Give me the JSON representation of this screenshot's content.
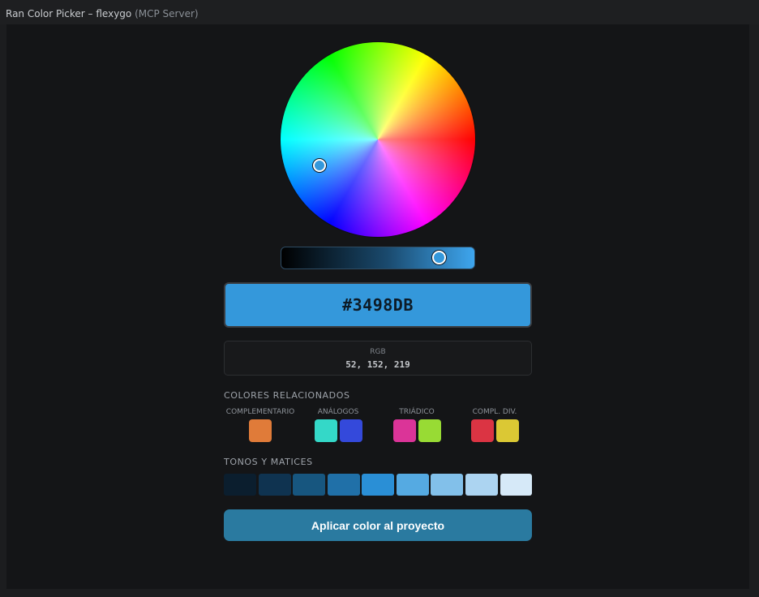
{
  "window": {
    "title_main": "Ran Color Picker – flexygo",
    "title_dim": " (MCP Server)"
  },
  "picker": {
    "current_color": "#3498db",
    "brightness_level_percent": 83
  },
  "hex": {
    "value": "#3498DB"
  },
  "rgb": {
    "label": "RGB",
    "value": "52, 152, 219"
  },
  "related": {
    "title": "COLORES RELACIONADOS",
    "groups": [
      {
        "label": "COMPLEMENTARIO",
        "colors": [
          "#e07b39"
        ]
      },
      {
        "label": "ANÁLOGOS",
        "colors": [
          "#34d8c8",
          "#3449db"
        ]
      },
      {
        "label": "TRIÁDICO",
        "colors": [
          "#db3498",
          "#98db34"
        ]
      },
      {
        "label": "COMPL. DIV.",
        "colors": [
          "#db3443",
          "#dbc834"
        ]
      }
    ]
  },
  "tones": {
    "title": "TONOS Y MATICES",
    "colors": [
      "#0b1e2e",
      "#0f3350",
      "#17567f",
      "#2070a8",
      "#2a8fd6",
      "#55aae2",
      "#82c0ea",
      "#acd4f1",
      "#d6e9f8"
    ]
  },
  "apply_button": {
    "label": "Aplicar color al proyecto"
  },
  "colors": {
    "background": "#141517",
    "accent": "#3498db",
    "button": "#2a7aa0"
  }
}
